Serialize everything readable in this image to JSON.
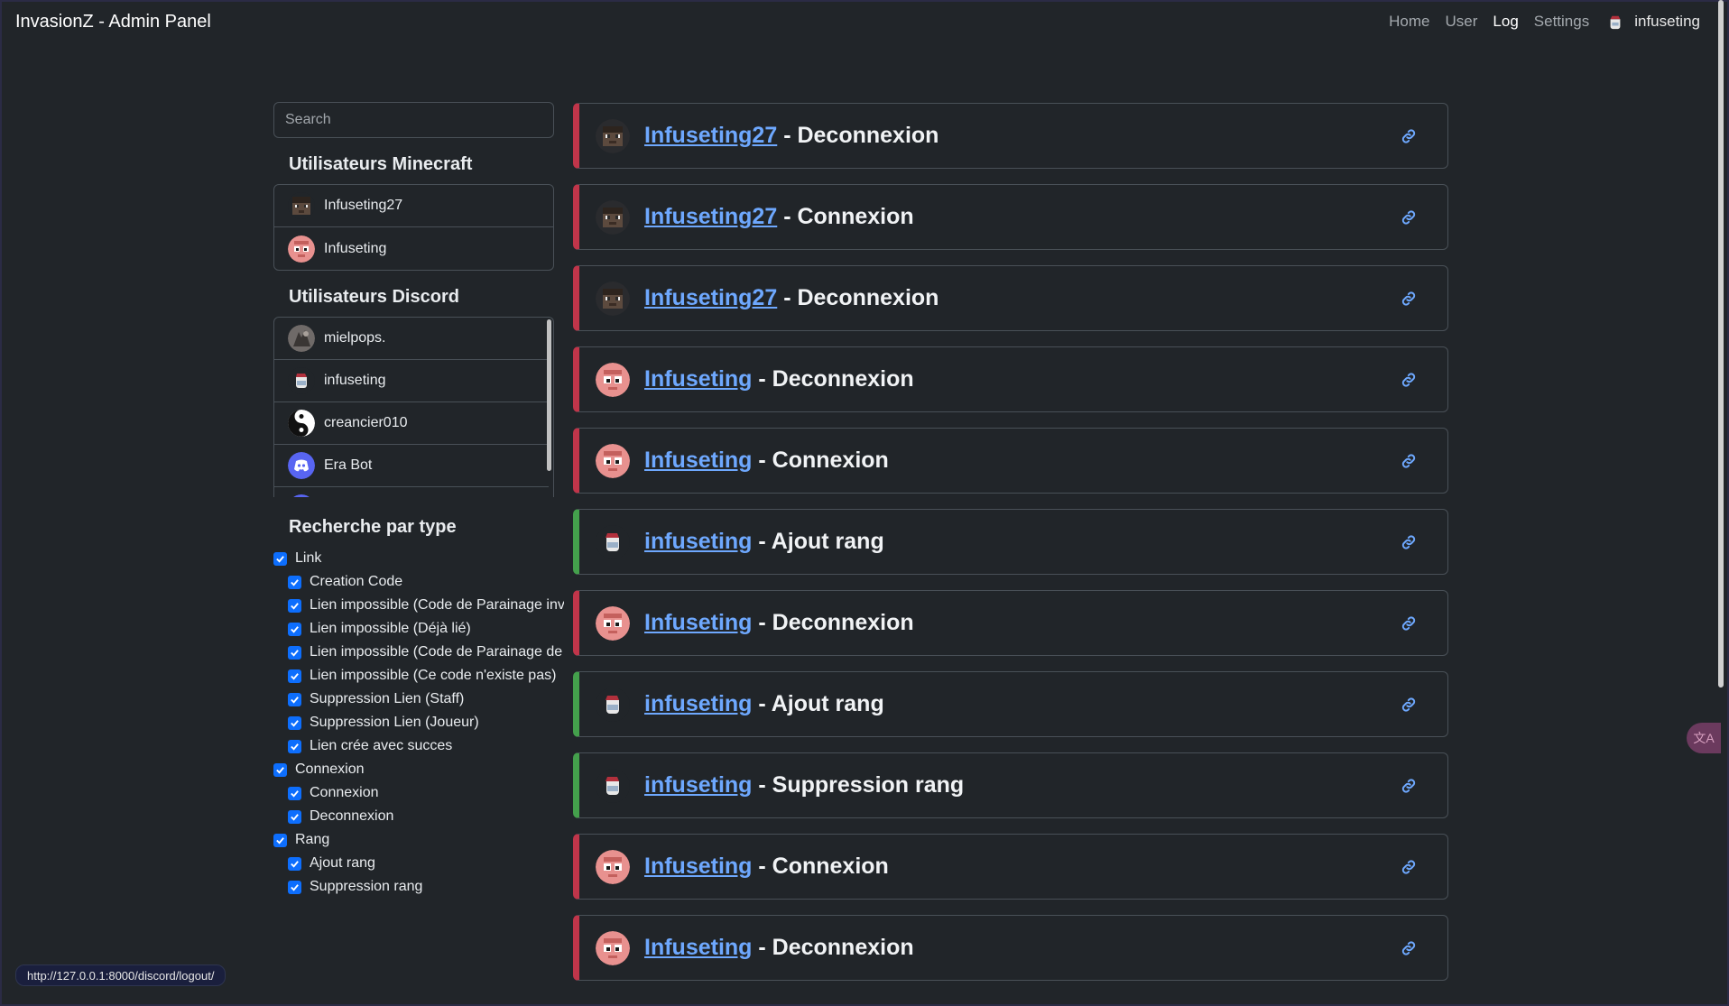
{
  "navbar": {
    "brand": "InvasionZ - Admin Panel",
    "links": {
      "home": "Home",
      "user": "User",
      "log": "Log",
      "settings": "Settings"
    },
    "username": "infuseting"
  },
  "sidebar": {
    "search_placeholder": "Search",
    "minecraft_title": "Utilisateurs Minecraft",
    "minecraft_users": [
      "Infuseting27",
      "Infuseting"
    ],
    "discord_title": "Utilisateurs Discord",
    "discord_users": [
      "mielpops.",
      "infuseting",
      "creancier010",
      "Era Bot"
    ],
    "filter_title": "Recherche par type",
    "filters": {
      "link": "Link",
      "link_children": [
        "Creation Code",
        "Lien impossible (Code de Parainage invalide)",
        "Lien impossible (Déjà lié)",
        "Lien impossible (Code de Parainage de soi)",
        "Lien impossible (Ce code n'existe pas)",
        "Suppression Lien (Staff)",
        "Suppression Lien (Joueur)",
        "Lien crée avec succes"
      ],
      "connexion": "Connexion",
      "connexion_children": [
        "Connexion",
        "Deconnexion"
      ],
      "rang": "Rang",
      "rang_children": [
        "Ajout rang",
        "Suppression rang"
      ]
    }
  },
  "logs": [
    {
      "user": "Infuseting27",
      "action": "Deconnexion",
      "kind": "minecraft27",
      "color": "red"
    },
    {
      "user": "Infuseting27",
      "action": "Connexion",
      "kind": "minecraft27",
      "color": "red"
    },
    {
      "user": "Infuseting27",
      "action": "Deconnexion",
      "kind": "minecraft27",
      "color": "red"
    },
    {
      "user": "Infuseting",
      "action": "Deconnexion",
      "kind": "minecraft",
      "color": "red"
    },
    {
      "user": "Infuseting",
      "action": "Connexion",
      "kind": "minecraft",
      "color": "red"
    },
    {
      "user": "infuseting",
      "action": "Ajout rang",
      "kind": "discord",
      "color": "green"
    },
    {
      "user": "Infuseting",
      "action": "Deconnexion",
      "kind": "minecraft",
      "color": "red"
    },
    {
      "user": "infuseting",
      "action": "Ajout rang",
      "kind": "discord",
      "color": "green"
    },
    {
      "user": "infuseting",
      "action": "Suppression rang",
      "kind": "discord",
      "color": "green"
    },
    {
      "user": "Infuseting",
      "action": "Connexion",
      "kind": "minecraft",
      "color": "red"
    },
    {
      "user": "Infuseting",
      "action": "Deconnexion",
      "kind": "minecraft",
      "color": "red"
    }
  ],
  "status_url": "http://127.0.0.1:8000/discord/logout/",
  "colors": {
    "accent": "#0d6efd",
    "link": "#6ea8fe",
    "red": "#c0354a",
    "green": "#44a04c"
  }
}
